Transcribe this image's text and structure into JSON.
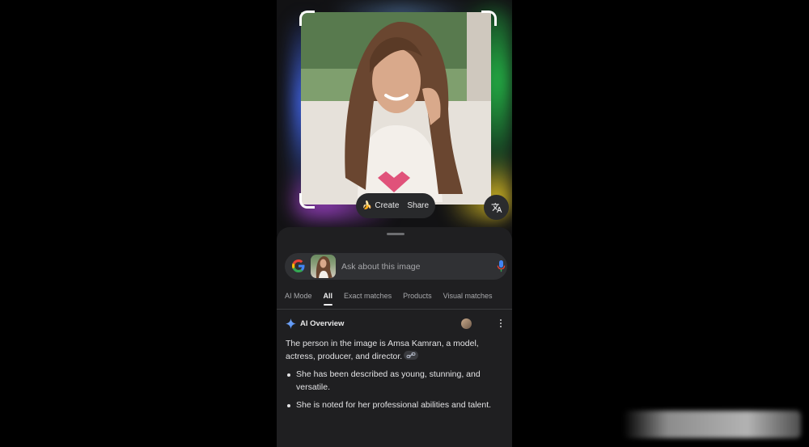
{
  "viewer": {
    "create_label": "Create",
    "create_icon": "banana-icon",
    "share_label": "Share",
    "translate_icon": "translate-icon"
  },
  "search": {
    "placeholder": "Ask about this image",
    "logo": "google-g-logo",
    "mic_icon": "mic-icon"
  },
  "tabs": [
    {
      "label": "AI Mode",
      "active": false
    },
    {
      "label": "All",
      "active": true
    },
    {
      "label": "Exact matches",
      "active": false
    },
    {
      "label": "Products",
      "active": false
    },
    {
      "label": "Visual matches",
      "active": false
    }
  ],
  "overview": {
    "title": "AI Overview",
    "icon": "sparkle-icon",
    "summary": "The person in the image is Amsa Kamran, a model, actress, producer, and director.",
    "bullets": [
      "She has been described as young, stunning, and versatile.",
      "She is noted for her professional abilities and talent."
    ]
  },
  "colors": {
    "background": "#000000",
    "sheet": "#1f1f21",
    "search_bar": "#303134",
    "accent_blue": "#4285f4"
  }
}
